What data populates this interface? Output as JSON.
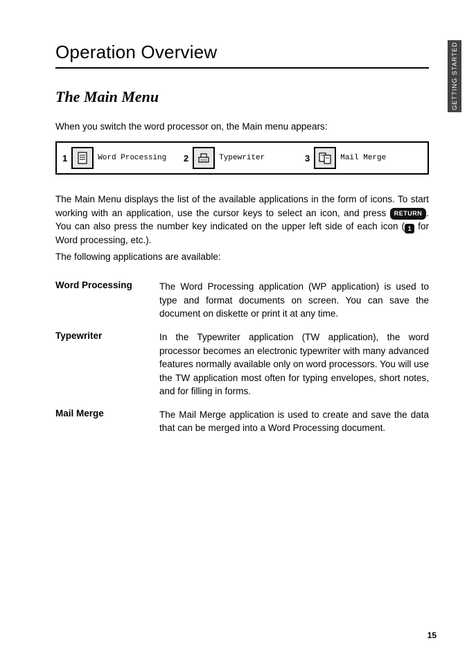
{
  "tab": "GETTING STARTED",
  "title": "Operation Overview",
  "section_title": "The Main Menu",
  "intro": "When you switch the word processor on, the Main menu appears:",
  "menu": [
    {
      "num": "1",
      "label": "Word Processing",
      "icon": "document-icon"
    },
    {
      "num": "2",
      "label": "Typewriter",
      "icon": "typewriter-icon"
    },
    {
      "num": "3",
      "label": "Mail Merge",
      "icon": "mailmerge-icon"
    }
  ],
  "para1": "The Main Menu displays the list of the available applications in the form of icons. To start working with an application, use the cursor keys to select an icon, and press ",
  "key_return": "RETURN",
  "para1b": ". You can also press the number key indicated on the upper left side of each icon (",
  "key_one": "1",
  "para1c": " for Word processing, etc.).",
  "para2": "The following applications are available:",
  "apps": [
    {
      "term": "Word Processing",
      "desc": "The Word Processing application (WP application) is used to type and format documents on screen. You can save the document on diskette or print it at any time."
    },
    {
      "term": "Typewriter",
      "desc": "In the Typewriter application (TW application), the word processor becomes an electronic typewriter with many advanced features normally available only on word processors. You will use the TW application most often for typing envelopes, short notes, and for filling in forms."
    },
    {
      "term": "Mail Merge",
      "desc": "The Mail Merge application is used to create and save the data that can be merged into a Word Processing document."
    }
  ],
  "page_number": "15"
}
